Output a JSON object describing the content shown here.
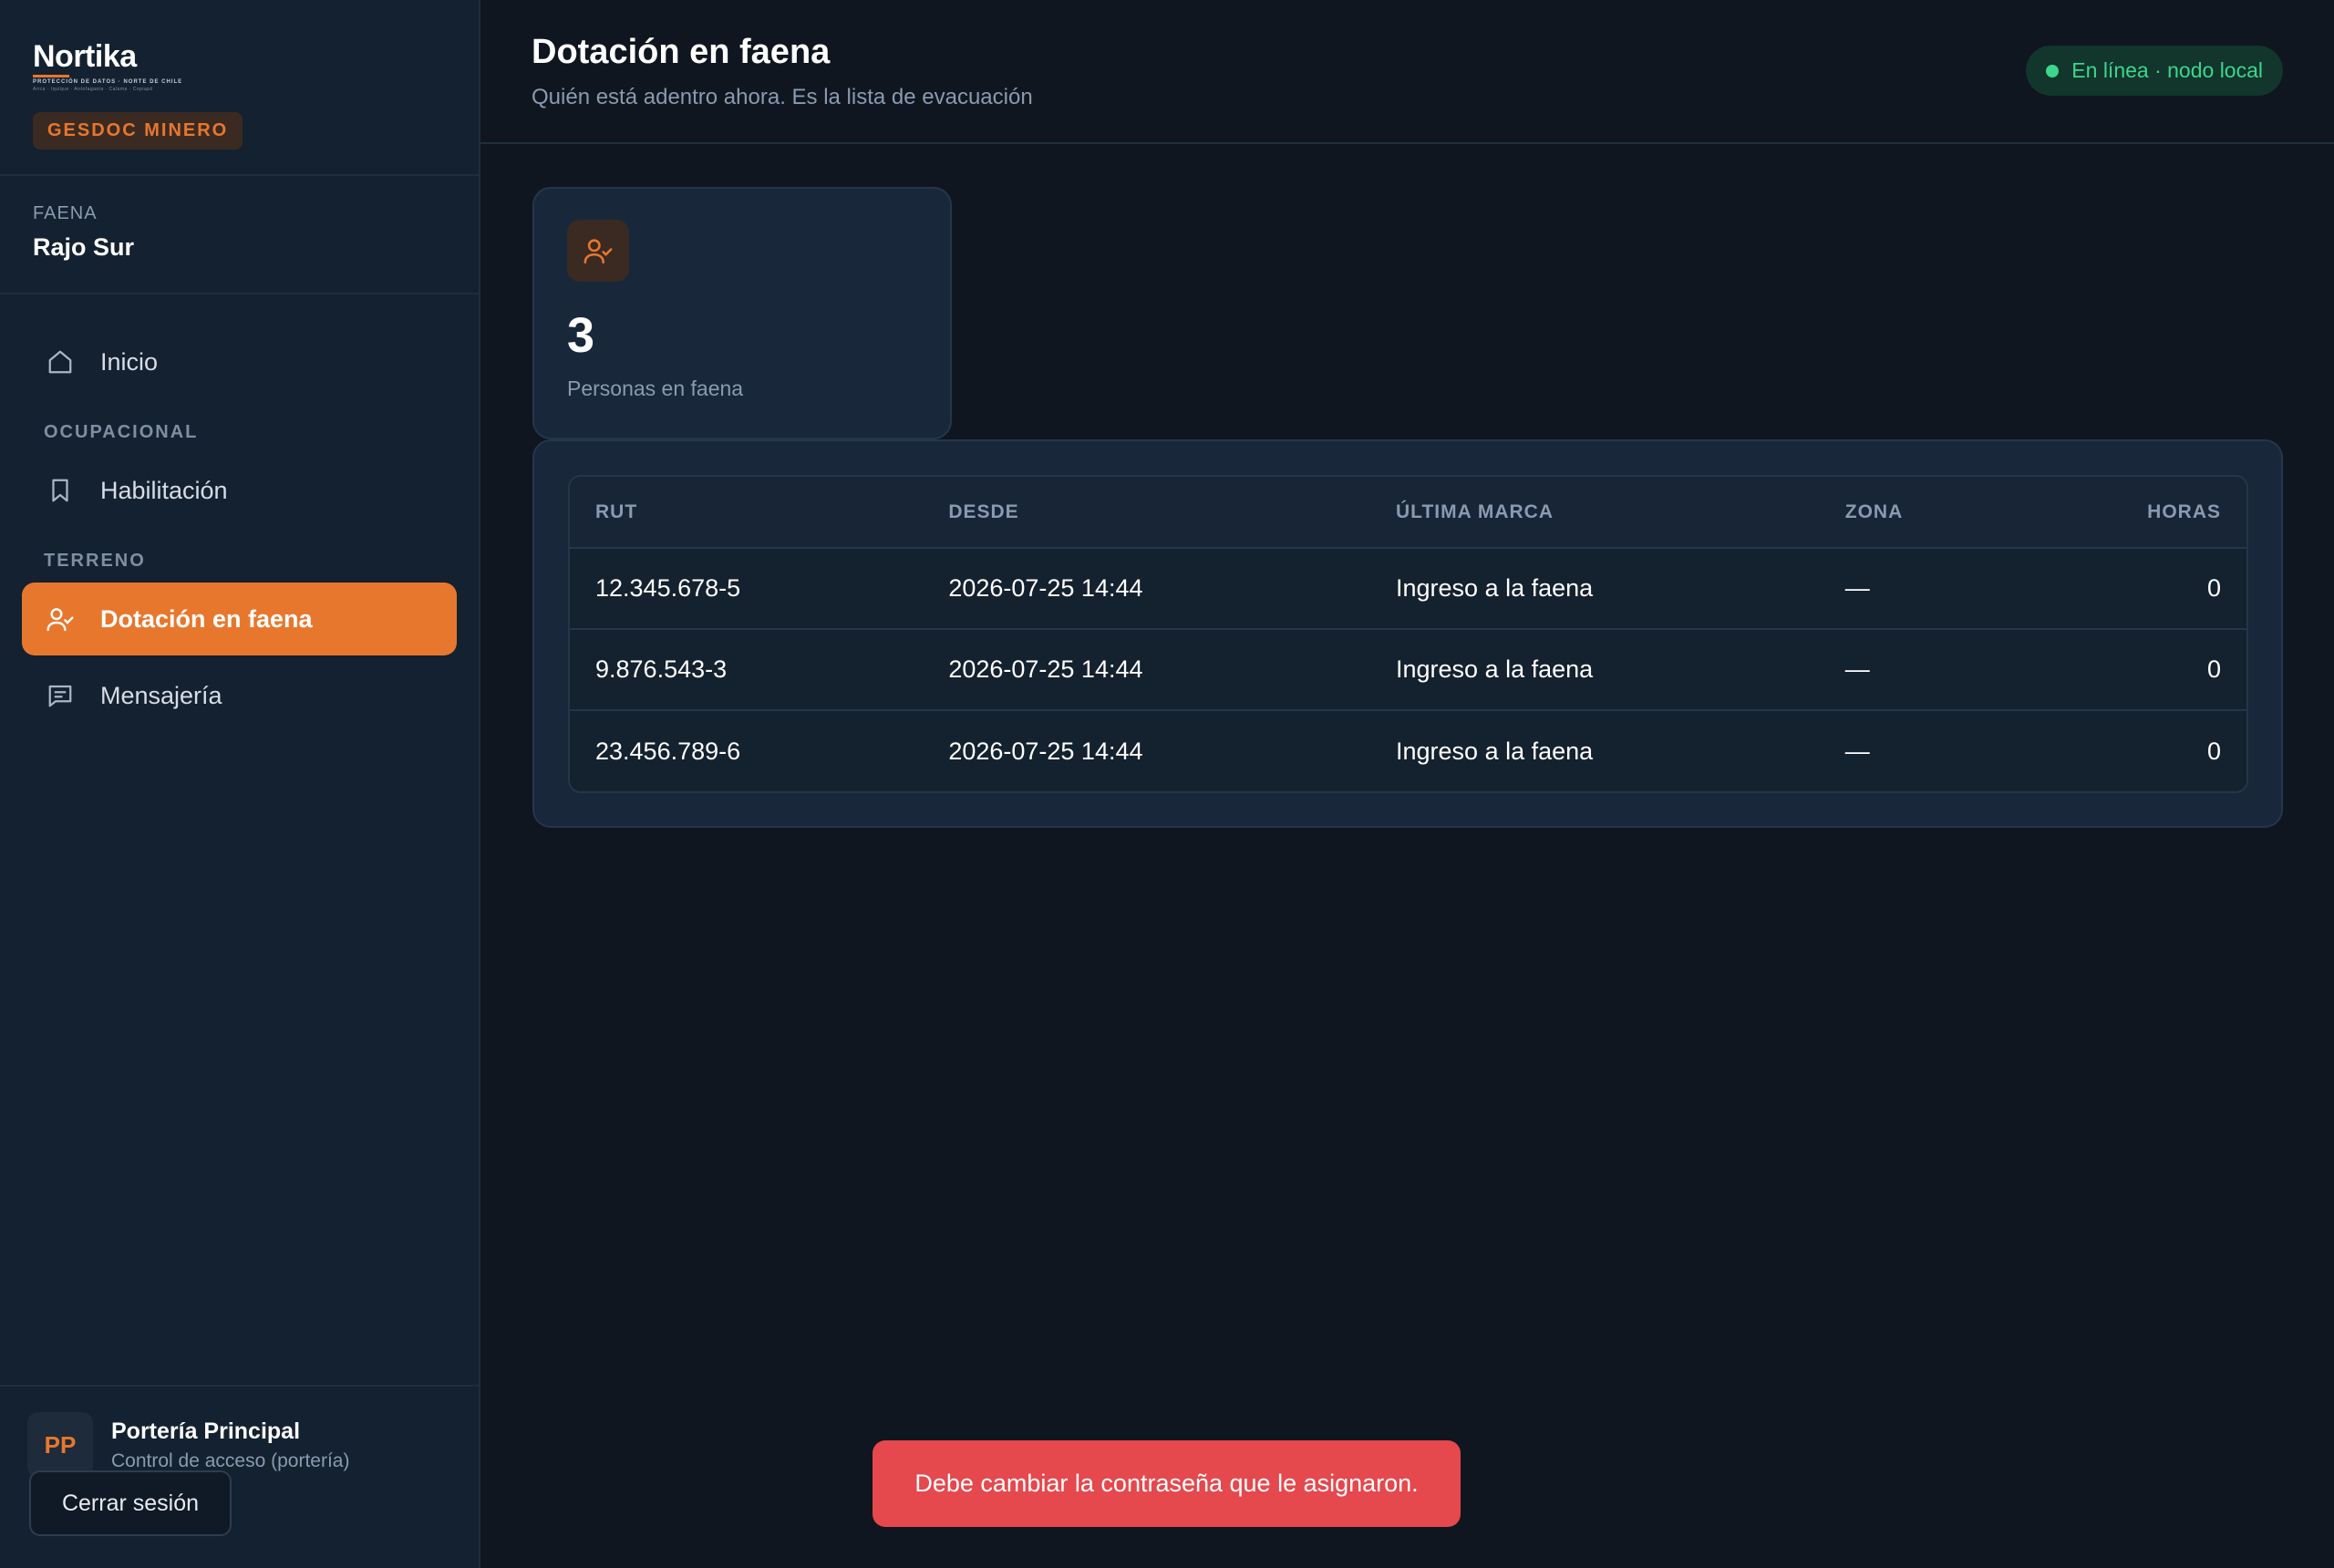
{
  "brand": {
    "logo_text": "Nortika",
    "logo_tagline": "PROTECCIÓN DE DATOS · NORTE DE CHILE",
    "logo_cities": "Arica · Iquique · Antofagasta · Calama · Copiapó",
    "product_badge": "GESDOC MINERO"
  },
  "faena": {
    "label": "FAENA",
    "value": "Rajo Sur"
  },
  "nav": {
    "inicio": "Inicio",
    "section_ocupacional": "OCUPACIONAL",
    "habilitacion": "Habilitación",
    "section_terreno": "TERRENO",
    "dotacion": "Dotación en faena",
    "mensajeria": "Mensajería"
  },
  "user": {
    "initials": "PP",
    "name": "Portería Principal",
    "role": "Control de acceso (portería)",
    "logout_label": "Cerrar sesión"
  },
  "header": {
    "title": "Dotación en faena",
    "subtitle": "Quién está adentro ahora. Es la lista de evacuación",
    "status": "En línea · nodo local"
  },
  "stat": {
    "value": "3",
    "label": "Personas en faena"
  },
  "table": {
    "columns": [
      "RUT",
      "DESDE",
      "ÚLTIMA MARCA",
      "ZONA",
      "HORAS"
    ],
    "rows": [
      [
        "12.345.678-5",
        "2026-07-25 14:44",
        "Ingreso a la faena",
        "—",
        "0"
      ],
      [
        "9.876.543-3",
        "2026-07-25 14:44",
        "Ingreso a la faena",
        "—",
        "0"
      ],
      [
        "23.456.789-6",
        "2026-07-25 14:44",
        "Ingreso a la faena",
        "—",
        "0"
      ]
    ]
  },
  "toast": {
    "message": "Debe cambiar la contraseña que le asignaron."
  },
  "colors": {
    "accent": "#e8772e",
    "background": "#0f161f",
    "sidebar": "#142130",
    "status_green": "#3dd68c",
    "toast_red": "#e5484d"
  }
}
